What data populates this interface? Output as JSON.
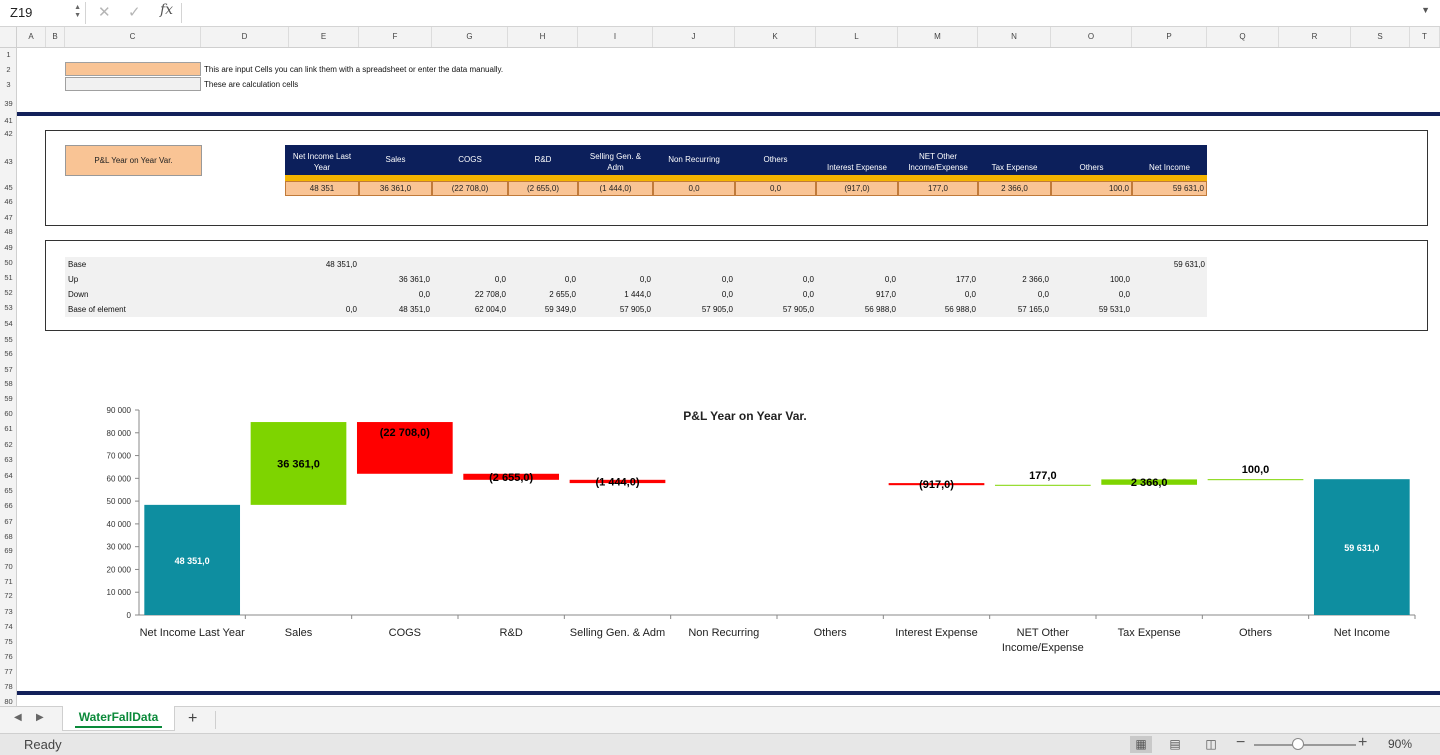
{
  "formula_bar": {
    "name_box": "Z19",
    "formula": ""
  },
  "columns": [
    "A",
    "B",
    "C",
    "D",
    "E",
    "F",
    "G",
    "H",
    "I",
    "J",
    "K",
    "L",
    "M",
    "N",
    "O",
    "P",
    "Q",
    "R",
    "S",
    "T"
  ],
  "rows": [
    "1",
    "2",
    "3",
    "39",
    "41",
    "42",
    "43",
    "45",
    "46",
    "47",
    "48",
    "49",
    "50",
    "51",
    "52",
    "53",
    "54",
    "55",
    "56",
    "57",
    "58",
    "59",
    "60",
    "61",
    "62",
    "63",
    "64",
    "65",
    "66",
    "67",
    "68",
    "69",
    "70",
    "71",
    "72",
    "73",
    "74",
    "75",
    "76",
    "77",
    "78",
    "80"
  ],
  "legend": {
    "input_text": "This are input Cells you can link them with a spreadsheet or enter the data manually.",
    "calc_text": "These are calculation cells",
    "input_color": "#f9c495",
    "calc_color": "#f1f1f1"
  },
  "pl_table": {
    "label": "P&L Year on Year Var.",
    "headers": [
      "Net Income Last Year",
      "Sales",
      "COGS",
      "R&D",
      "Selling Gen. & Adm",
      "Non Recurring",
      "Others",
      "Interest Expense",
      "NET Other Income/Expense",
      "Tax Expense",
      "Others",
      "Net Income"
    ],
    "values": [
      "48 351",
      "36 361,0",
      "(22 708,0)",
      "(2 655,0)",
      "(1 444,0)",
      "0,0",
      "0,0",
      "(917,0)",
      "177,0",
      "2 366,0",
      "100,0",
      "59 631,0"
    ],
    "header_color": "#0c1f5b",
    "strip_color": "#f4b400"
  },
  "calc_table": {
    "rows": [
      {
        "label": "Base",
        "values": [
          "48 351,0",
          "",
          "",
          "",
          "",
          "",
          "",
          "",
          "",
          "",
          "",
          "59 631,0"
        ]
      },
      {
        "label": "Up",
        "values": [
          "",
          "36 361,0",
          "0,0",
          "0,0",
          "0,0",
          "0,0",
          "0,0",
          "0,0",
          "177,0",
          "2 366,0",
          "100,0",
          ""
        ]
      },
      {
        "label": "Down",
        "values": [
          "",
          "0,0",
          "22 708,0",
          "2 655,0",
          "1 444,0",
          "0,0",
          "0,0",
          "917,0",
          "0,0",
          "0,0",
          "0,0",
          ""
        ]
      },
      {
        "label": "Base of element",
        "values": [
          "0,0",
          "48 351,0",
          "62 004,0",
          "59 349,0",
          "57 905,0",
          "57 905,0",
          "57 905,0",
          "56 988,0",
          "56 988,0",
          "57 165,0",
          "59 531,0",
          ""
        ]
      }
    ]
  },
  "chart_data": {
    "type": "bar",
    "title": "P&L Year on Year Var.",
    "categories": [
      "Net Income Last Year",
      "Sales",
      "COGS",
      "R&D",
      "Selling Gen. & Adm",
      "Non Recurring",
      "Others",
      "Interest Expense",
      "NET Other Income/Expense",
      "Tax Expense",
      "Others",
      "Net Income"
    ],
    "series": [
      {
        "values": [
          48351,
          0,
          0,
          0,
          0,
          0,
          0,
          0,
          0,
          0,
          0,
          59631
        ],
        "color": "#0e8ea0"
      },
      {
        "values": [
          0,
          36361,
          0,
          0,
          0,
          0,
          0,
          0,
          177,
          2366,
          100,
          0
        ],
        "color": "#7ed400"
      },
      {
        "values": [
          0,
          0,
          22708,
          2655,
          1444,
          0,
          0,
          917,
          0,
          0,
          0,
          0
        ],
        "color": "#ff0000"
      }
    ],
    "base_of_element": [
      0,
      48351,
      62004,
      59349,
      57905,
      57905,
      57905,
      56988,
      56988,
      57165,
      59531,
      0
    ],
    "data_labels": [
      "48 351,0",
      "36 361,0",
      "(22 708,0)",
      "(2 655,0)",
      "(1 444,0)",
      "",
      "",
      "(917,0)",
      "177,0",
      "2 366,0",
      "100,0",
      "59 631,0"
    ],
    "yticks": [
      "0",
      "10 000",
      "20 000",
      "30 000",
      "40 000",
      "50 000",
      "60 000",
      "70 000",
      "80 000",
      "90 000"
    ],
    "ylim": [
      0,
      90000
    ],
    "grid": false,
    "legend": "none"
  },
  "sheet_tabs": [
    {
      "label": "WaterFallData",
      "active": true
    }
  ],
  "status": {
    "text": "Ready",
    "zoom": "90%"
  }
}
